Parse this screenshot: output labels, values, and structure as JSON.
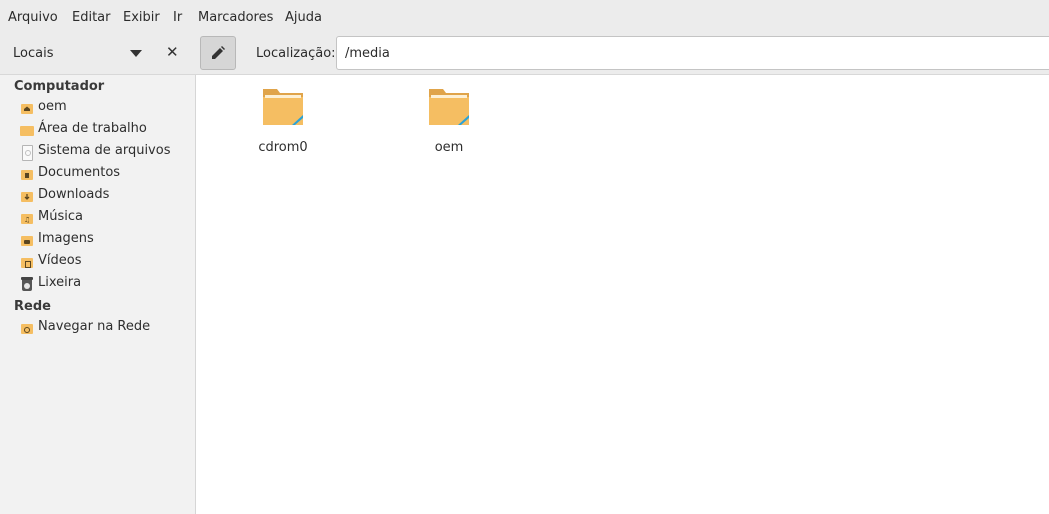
{
  "menu": [
    "Arquivo",
    "Editar",
    "Exibir",
    "Ir",
    "Marcadores",
    "Ajuda"
  ],
  "sidebar_title": "Locais",
  "location_label": "Localização:",
  "location_value": "/media",
  "sections": [
    {
      "title": "Computador",
      "items": [
        {
          "label": "oem",
          "icon": "home-folder-icon"
        },
        {
          "label": "Área de trabalho",
          "icon": "desktop-folder-icon"
        },
        {
          "label": "Sistema de arquivos",
          "icon": "filesystem-icon"
        },
        {
          "label": "Documentos",
          "icon": "documents-folder-icon"
        },
        {
          "label": "Downloads",
          "icon": "downloads-folder-icon"
        },
        {
          "label": "Música",
          "icon": "music-folder-icon"
        },
        {
          "label": "Imagens",
          "icon": "pictures-folder-icon"
        },
        {
          "label": "Vídeos",
          "icon": "videos-folder-icon"
        },
        {
          "label": "Lixeira",
          "icon": "trash-icon"
        }
      ]
    },
    {
      "title": "Rede",
      "items": [
        {
          "label": "Navegar na Rede",
          "icon": "network-folder-icon"
        }
      ]
    }
  ],
  "files": [
    {
      "name": "cdrom0",
      "icon": "folder-link-icon"
    },
    {
      "name": "oem",
      "icon": "folder-link-icon"
    }
  ],
  "colors": {
    "folder": "#f5be62",
    "folder_dark": "#e0a44a",
    "link_accent": "#2aa3d8",
    "chrome": "#ececec"
  }
}
